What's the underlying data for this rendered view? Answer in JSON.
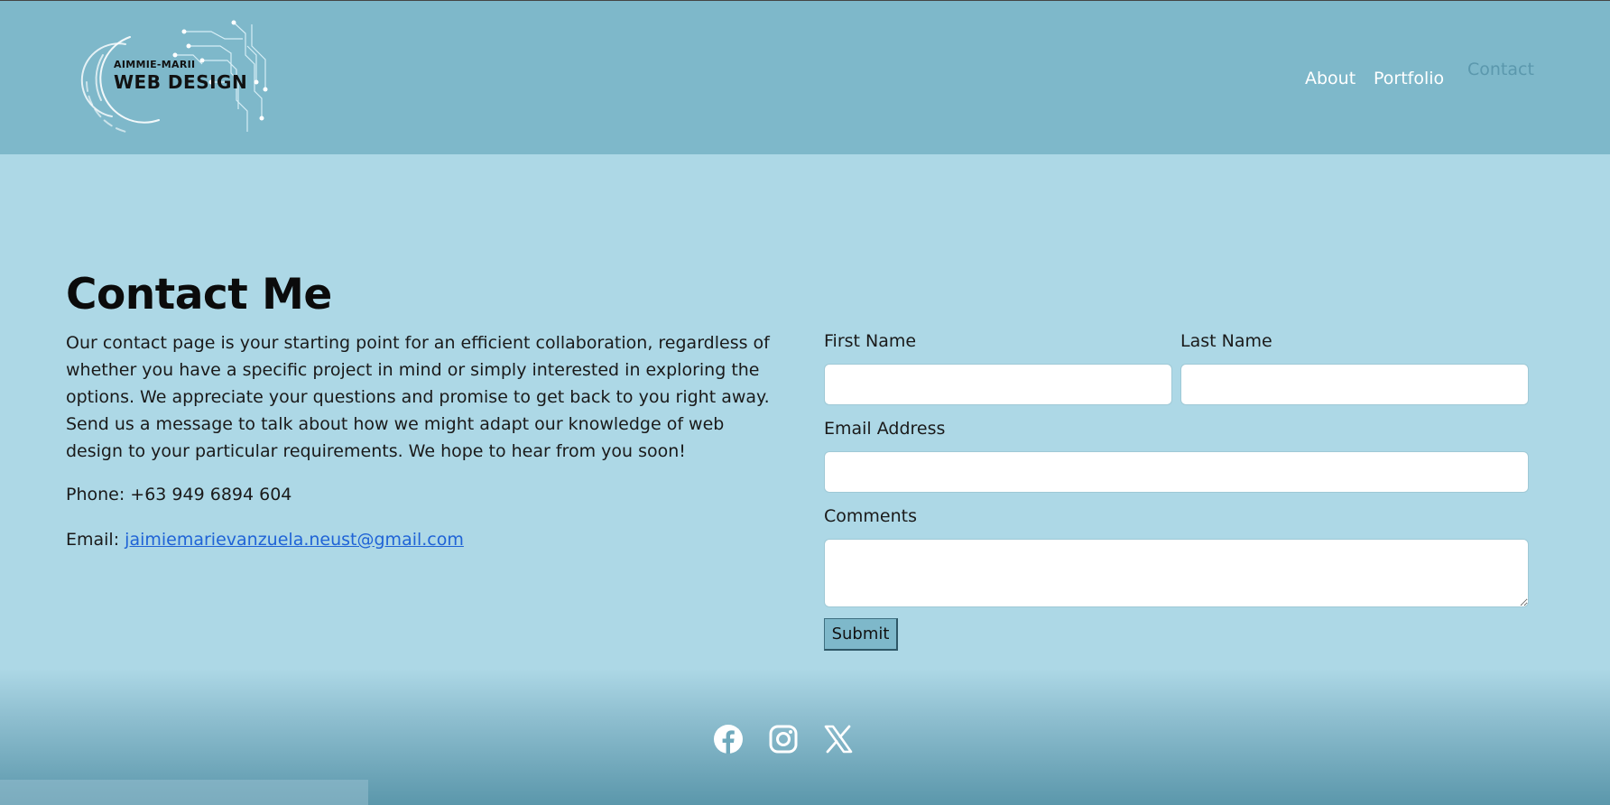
{
  "logo": {
    "top_text": "AIMMIE-MARII",
    "main_text": "WEB DESIGN"
  },
  "nav": {
    "items": [
      {
        "label": "About"
      },
      {
        "label": "Portfolio"
      },
      {
        "label": "Contact"
      }
    ]
  },
  "main": {
    "title": "Contact Me",
    "intro": "Our contact page is your starting point for an efficient collaboration, regardless of whether you have a specific project in mind or simply interested in exploring the options. We appreciate your questions and promise to get back to you right away. Send us a message to talk about how we might adapt our knowledge of web design to your particular requirements. We hope to hear from you soon!",
    "phone": "Phone: +63 949 6894 604",
    "email_label": "Email:",
    "email_value": "jaimiemarievanzuela.neust@gmail.com"
  },
  "form": {
    "first_name_label": "First Name",
    "first_name_value": "",
    "last_name_label": "Last Name",
    "last_name_value": "",
    "email_label": "Email Address",
    "email_value": "",
    "comments_label": "Comments",
    "comments_value": "",
    "submit_label": "Submit"
  },
  "footer": {
    "social_icons": [
      "facebook-icon",
      "instagram-icon",
      "x-icon"
    ]
  },
  "colors": {
    "header_bg": "#7eb8ca",
    "page_bg": "#add8e6",
    "active_nav": "#5b98ad",
    "link": "#1f63d6"
  }
}
